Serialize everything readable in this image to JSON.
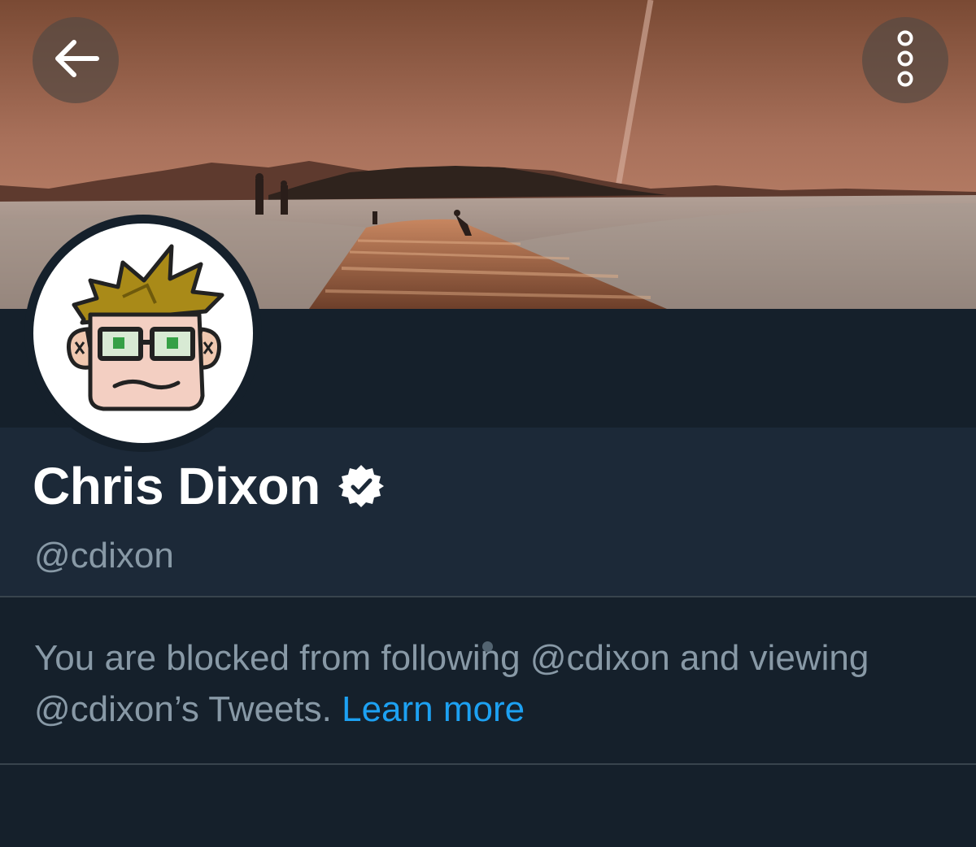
{
  "profile": {
    "display_name": "Chris Dixon",
    "handle": "@cdixon",
    "verified": true
  },
  "blocked_notice": {
    "text": "You are blocked from following @cdixon and viewing @cdixon’s Tweets.",
    "link_label": "Learn more"
  },
  "icons": {
    "back": "arrow-left-icon",
    "more": "more-vertical-icon",
    "verified": "verified-badge-icon"
  },
  "colors": {
    "background": "#15202b",
    "profile_panel": "#1c2938",
    "name_text": "#ffffff",
    "secondary_text": "#8899a6",
    "link": "#1da1f2",
    "divider": "#38444d"
  }
}
